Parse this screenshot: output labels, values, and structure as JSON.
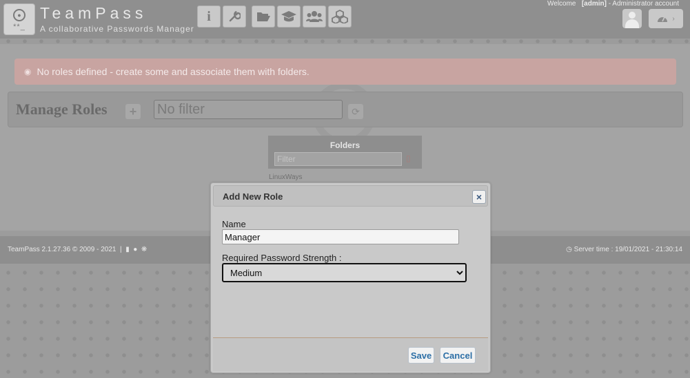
{
  "header": {
    "app_title": "TeamPass",
    "app_subtitle": "A collaborative Passwords Manager",
    "welcome_prefix": "Welcome",
    "welcome_user": "[admin]",
    "welcome_suffix": "- Administrator account",
    "nav_icons": [
      "info-icon",
      "wrench-icon",
      "folder-open-icon",
      "graduation-cap-icon",
      "users-icon",
      "cubes-icon"
    ]
  },
  "alert": {
    "text": "No roles defined - create some and associate them with folders."
  },
  "roles_toolbar": {
    "title": "Manage Roles",
    "filter_placeholder": "No filter"
  },
  "folders_panel": {
    "title": "Folders",
    "filter_placeholder": "Filter",
    "tree_root": "LinuxWays"
  },
  "footer": {
    "left_text": "TeamPass 2.1.27.36 © 2009 - 2021",
    "right_text": "Server time : 19/01/2021 - 21:30:14"
  },
  "dialog": {
    "title": "Add New Role",
    "name_label": "Name",
    "name_value": "Manager",
    "strength_label": "Required Password Strength :",
    "strength_selected": "Medium",
    "save_label": "Save",
    "cancel_label": "Cancel"
  },
  "colors": {
    "alert_bg": "#c8a4a1",
    "dialog_button_text": "#2d6fa6",
    "overlay": "#9c9c9c"
  }
}
